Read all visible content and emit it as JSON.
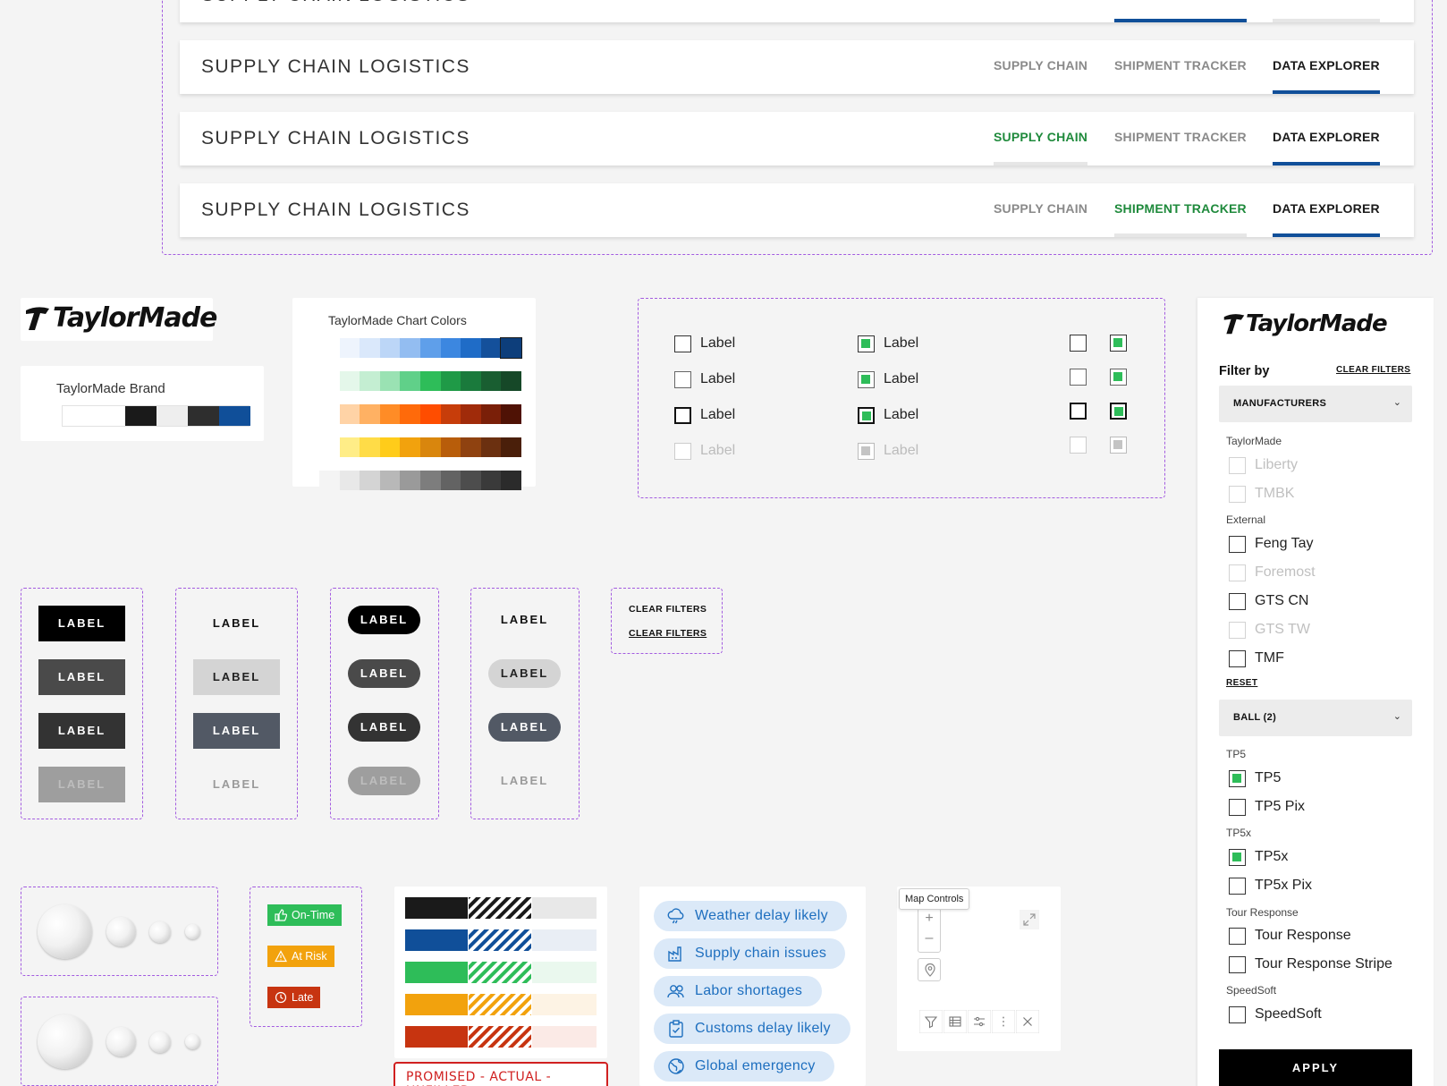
{
  "navbars": {
    "title": "SUPPLY CHAIN LOGISTICS",
    "tab_supply": "SUPPLY CHAIN",
    "tab_shipment": "SHIPMENT TRACKER",
    "tab_data": "DATA EXPLORER"
  },
  "brand": {
    "logo_text": "TaylorMade",
    "brand_card_title": "TaylorMade Brand",
    "chart_colors_title": "TaylorMade Chart Colors",
    "brand_colors": [
      "#ffffff",
      "#ffffff",
      "#1a1a1a",
      "#eeeeee",
      "#2e2e2e",
      "#104f99"
    ],
    "chart_palette": [
      [
        "#eef4fd",
        "#dae8fb",
        "#bcd6f7",
        "#93bdf1",
        "#5f9fea",
        "#3c87e0",
        "#1f6cc7",
        "#14509b",
        "#0d3e7b"
      ],
      [
        "#e4f7ea",
        "#c4eed2",
        "#9ae2b3",
        "#60d089",
        "#2ebd59",
        "#1f9a47",
        "#1a7a3c",
        "#195e31",
        "#164828"
      ],
      [
        "#ffd3a6",
        "#ffb163",
        "#ff8c26",
        "#ff6a0a",
        "#ff4d00",
        "#c73d0a",
        "#a02b0a",
        "#7a1f08",
        "#4f1205"
      ],
      [
        "#ffed87",
        "#ffdc47",
        "#ffcc1a",
        "#f2a20d",
        "#d9860d",
        "#b85d0a",
        "#8f4210",
        "#6b3010",
        "#4a1f0a"
      ],
      [
        "#f4f4f4",
        "#e8e8e8",
        "#d4d4d4",
        "#b8b8b8",
        "#9a9a9a",
        "#7d7d7d",
        "#636363",
        "#4d4d4d",
        "#3a3a3a",
        "#2b2b2b"
      ]
    ]
  },
  "checkboxes": {
    "label": "Label"
  },
  "buttons": {
    "label": "LABEL",
    "clear_filters": "CLEAR FILTERS"
  },
  "status": {
    "on_time": "On-Time",
    "at_risk": "At Risk",
    "late": "Late",
    "colors": {
      "on_time": "#2ebd59",
      "at_risk": "#f2a20d",
      "late": "#c73410"
    }
  },
  "legend": {
    "promised_caption": "PROMISED - ACTUAL - UNFILLED"
  },
  "alerts": [
    {
      "label": "Weather delay likely",
      "icon": "weather-cloud-icon"
    },
    {
      "label": "Supply chain issues",
      "icon": "factory-icon"
    },
    {
      "label": "Labor shortages",
      "icon": "people-icon"
    },
    {
      "label": "Customs delay likely",
      "icon": "clipboard-icon"
    },
    {
      "label": "Global emergency",
      "icon": "globe-icon"
    }
  ],
  "map_controls": {
    "tooltip": "Map Controls",
    "zoom_in": "+",
    "zoom_out": "–"
  },
  "sidebar": {
    "filter_by": "Filter by",
    "clear_filters": "CLEAR FILTERS",
    "manufacturers_dropdown": "MANUFACTURERS",
    "group_taylormade": "TaylorMade",
    "liberty": "Liberty",
    "tmbk": "TMBK",
    "group_external": "External",
    "feng_tay": "Feng Tay",
    "foremost": "Foremost",
    "gts_cn": "GTS CN",
    "gts_tw": "GTS TW",
    "tmf": "TMF",
    "reset": "RESET",
    "ball_dropdown": "BALL (2)",
    "group_tp5": "TP5",
    "tp5": "TP5",
    "tp5_pix": "TP5 Pix",
    "group_tp5x": "TP5x",
    "tp5x": "TP5x",
    "tp5x_pix": "TP5x Pix",
    "group_tour": "Tour Response",
    "tour_response": "Tour Response",
    "tour_response_stripe": "Tour Response Stripe",
    "group_speedsoft": "SpeedSoft",
    "speedsoft": "SpeedSoft",
    "apply": "APPLY"
  }
}
